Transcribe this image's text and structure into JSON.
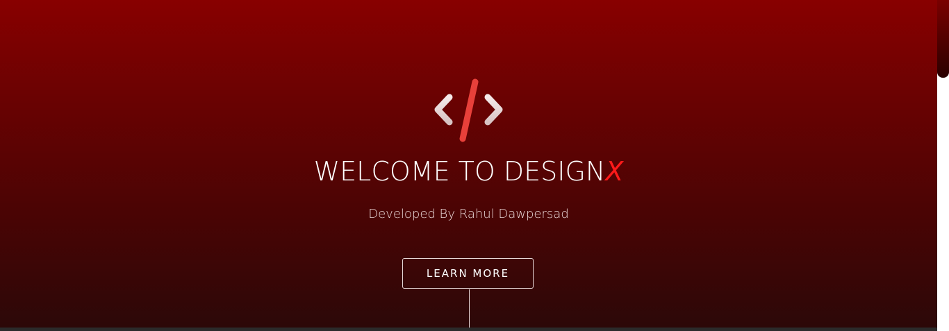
{
  "hero": {
    "title_main": "WELCOME TO DESIGN",
    "title_accent": "X",
    "subtitle": "Developed By Rahul Dawpersad",
    "button_label": "LEARN MORE",
    "logo_icon": "code-brackets-icon"
  },
  "colors": {
    "background_top": "#880000",
    "background_bottom": "#2c0808",
    "accent": "#ff1a1a",
    "logo_slash": "#e8403a",
    "logo_brackets": "#f0dada"
  },
  "scrollbar": {
    "position_fraction": 0.0
  }
}
